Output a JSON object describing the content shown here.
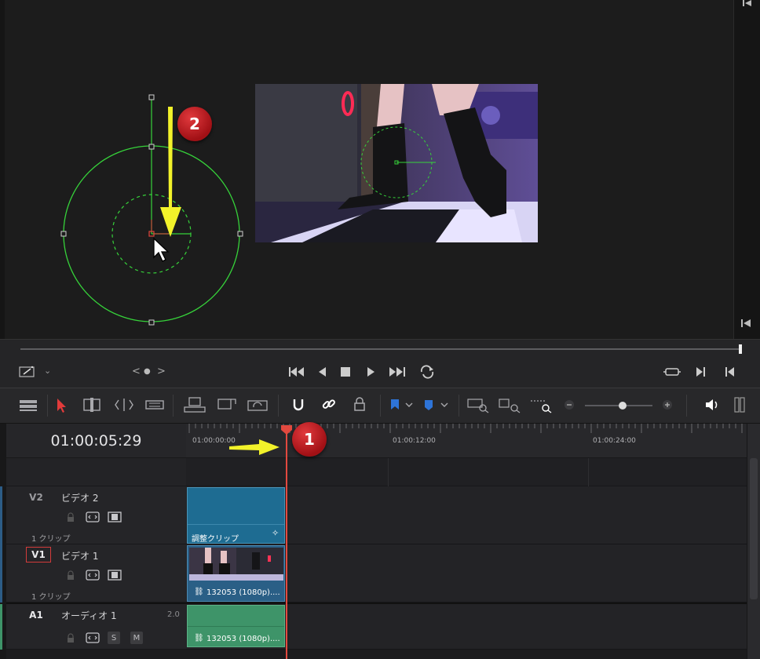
{
  "timecode": "01:00:05:29",
  "ruler": {
    "ticks": [
      "01:00:00:00",
      "01:00:12:00",
      "01:00:24:00"
    ]
  },
  "nav": {
    "prev": "<",
    "dot": "●",
    "next": ">"
  },
  "annotations": {
    "badge1": "1",
    "badge2": "2"
  },
  "tracks": {
    "v2": {
      "id": "V2",
      "name": "ビデオ 2",
      "clips": "1 クリップ",
      "clip_label": "調整クリップ"
    },
    "v1": {
      "id": "V1",
      "name": "ビデオ 1",
      "clips": "1 クリップ",
      "clip_label": "132053 (1080p)...."
    },
    "a1": {
      "id": "A1",
      "name": "オーディオ 1",
      "channels": "2.0",
      "solo": "S",
      "mute": "M",
      "clip_label": "132053 (1080p)...."
    }
  },
  "colors": {
    "playhead": "#e2493f",
    "video_adjust_clip": "#1e6c92",
    "audio_clip": "#3e9469",
    "overlay_green": "#36d23a",
    "arrow_yellow": "#f2f22a"
  }
}
